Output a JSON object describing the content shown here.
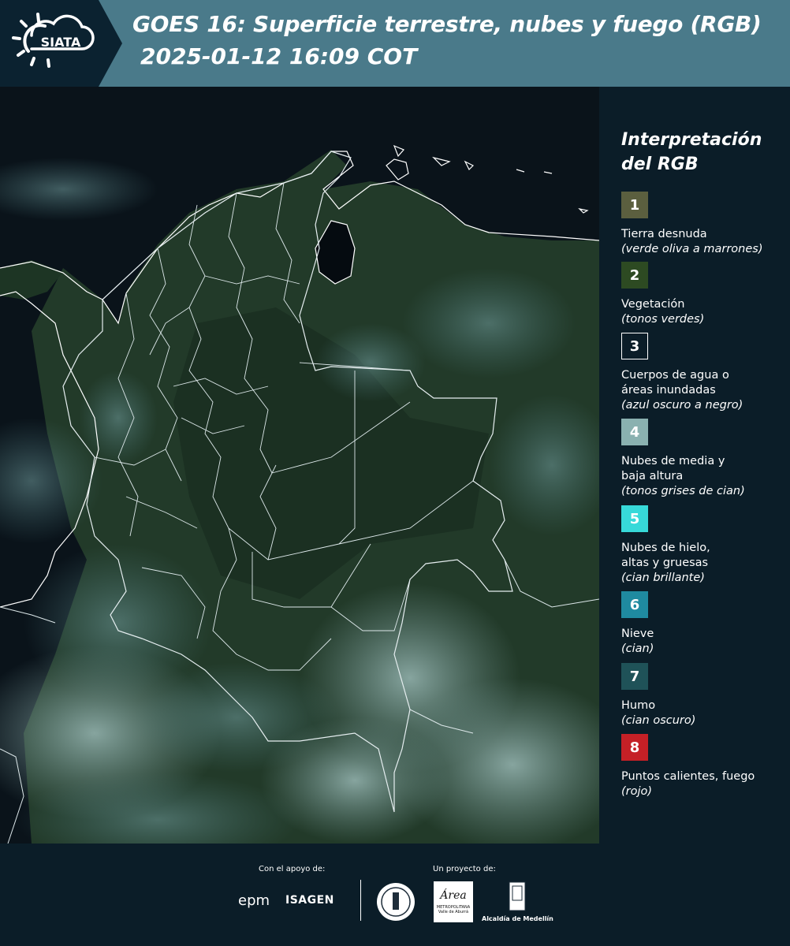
{
  "header": {
    "logo_text": "SIATA",
    "title_line1": "GOES 16: Superficie terrestre, nubes y fuego (RGB)",
    "title_line2": "2025-01-12 16:09 COT"
  },
  "map": {
    "icon": "satellite-map-colombia"
  },
  "legend": {
    "title_line1": "Interpretación",
    "title_line2": "del RGB",
    "items": [
      {
        "number": "1",
        "color": "#5b5f3f",
        "label": "Tierra desnuda",
        "label2": "",
        "note": "(verde oliva a marrones)"
      },
      {
        "number": "2",
        "color": "#2d4a22",
        "label": "Vegetación",
        "label2": "",
        "note": "(tonos verdes)"
      },
      {
        "number": "3",
        "color": "#0b1d28",
        "label": "Cuerpos de agua o",
        "label2": "áreas inundadas",
        "note": "(azul oscuro a negro)"
      },
      {
        "number": "4",
        "color": "#8ab1b0",
        "label": "Nubes de media y",
        "label2": "baja altura",
        "note": "(tonos grises de cian)"
      },
      {
        "number": "5",
        "color": "#37d9d9",
        "label": "Nubes de hielo,",
        "label2": "altas y gruesas",
        "note": "(cian brillante)"
      },
      {
        "number": "6",
        "color": "#1f8aa0",
        "label": "Nieve",
        "label2": "",
        "note": "(cian)"
      },
      {
        "number": "7",
        "color": "#1f5258",
        "label": "Humo",
        "label2": "",
        "note": "(cian oscuro)"
      },
      {
        "number": "8",
        "color": "#c52026",
        "label": "Puntos calientes, fuego",
        "label2": "",
        "note": "(rojo)"
      }
    ]
  },
  "footer": {
    "support_label": "Con el apoyo de:",
    "project_label": "Un proyecto de:",
    "epm": "epm",
    "isagen": "ISAGEN",
    "area_logo": "Área",
    "area_sub": "METROPOLITANA",
    "area_sub2": "Valle de Aburrá",
    "alcaldia": "Alcaldía de Medellín"
  }
}
